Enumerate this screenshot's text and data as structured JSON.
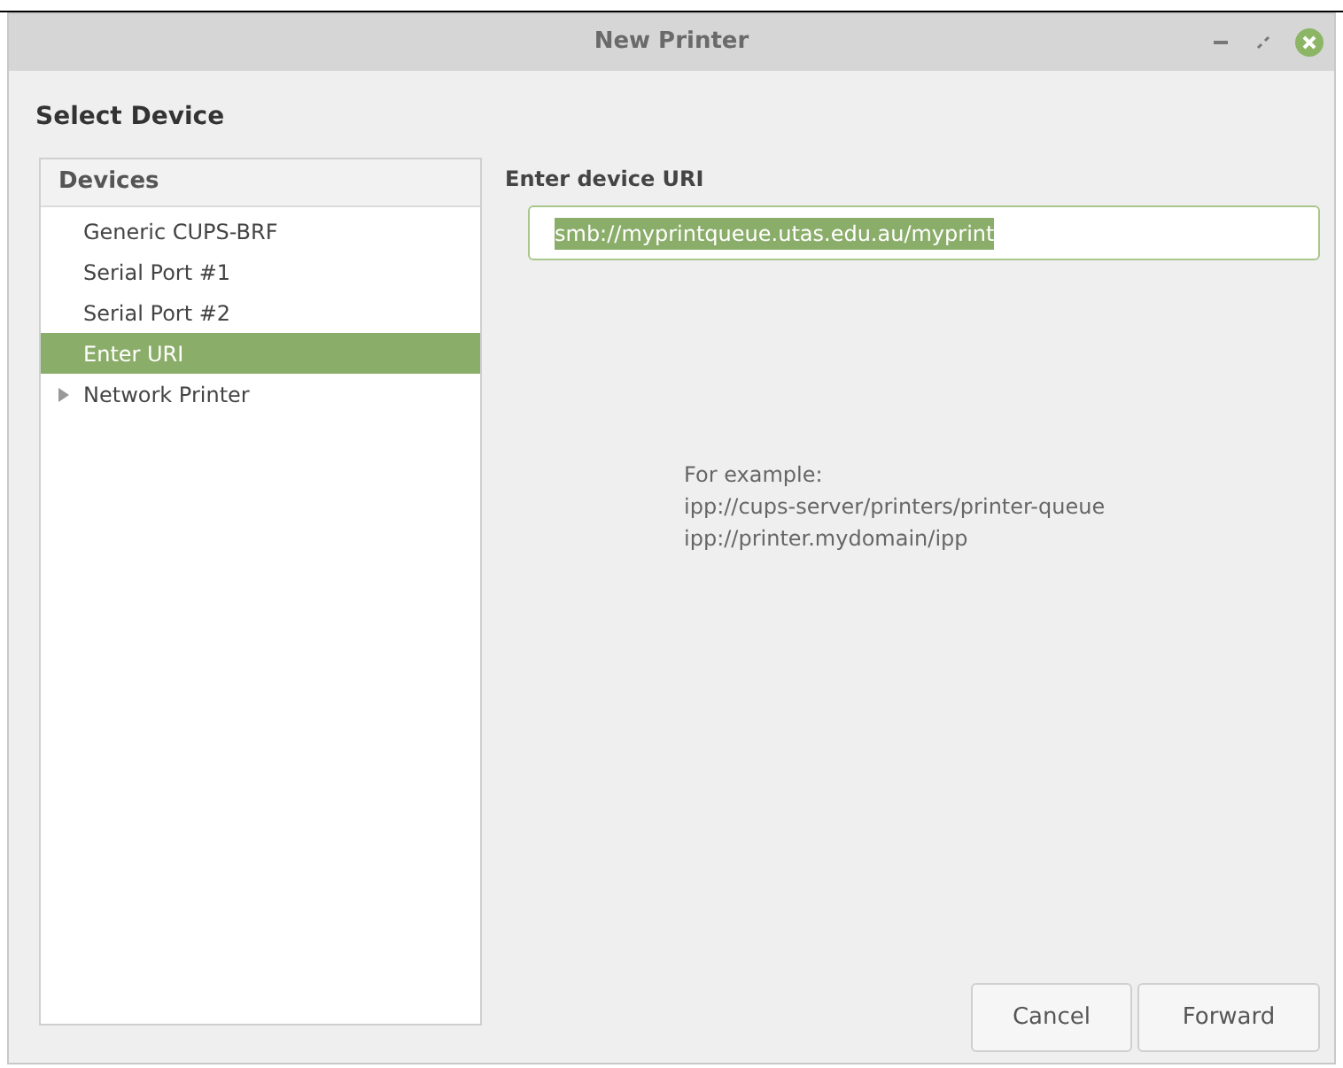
{
  "window": {
    "title": "New Printer"
  },
  "heading": "Select Device",
  "devices": {
    "header": "Devices",
    "items": [
      {
        "label": "Generic CUPS-BRF",
        "kind": "device",
        "selected": false
      },
      {
        "label": "Serial Port #1",
        "kind": "device",
        "selected": false
      },
      {
        "label": "Serial Port #2",
        "kind": "device",
        "selected": false
      },
      {
        "label": "Enter URI",
        "kind": "device",
        "selected": true
      },
      {
        "label": "Network Printer",
        "kind": "group",
        "expanded": false,
        "selected": false
      }
    ]
  },
  "uri": {
    "label": "Enter device URI",
    "value": "smb://myprintqueue.utas.edu.au/myprint",
    "text_selected": true
  },
  "example": [
    "For example:",
    "ipp://cups-server/printers/printer-queue",
    "ipp://printer.mydomain/ipp"
  ],
  "buttons": [
    "Cancel",
    "Forward"
  ]
}
